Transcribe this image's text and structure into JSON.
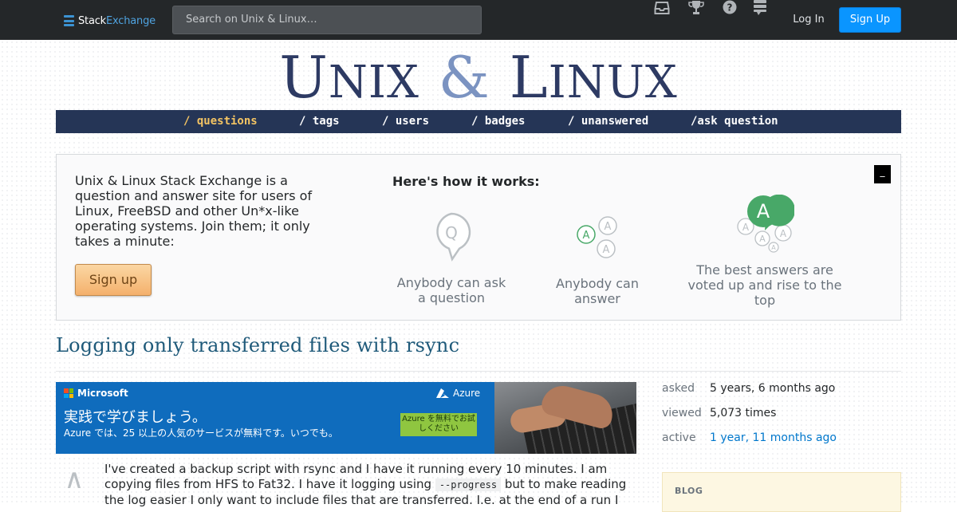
{
  "topbar": {
    "logo_stack": "Stack",
    "logo_exchange": "Exchange",
    "search_placeholder": "Search on Unix & Linux…",
    "icons": [
      "inbox-icon",
      "trophy-icon",
      "help-icon",
      "site-switcher-icon"
    ],
    "login_label": "Log In",
    "signup_label": "Sign Up"
  },
  "site": {
    "title_first": "U",
    "title_first_rest": "nix",
    "title_amp": "&",
    "title_second": "L",
    "title_second_rest": "inux"
  },
  "nav": {
    "items": [
      {
        "label": "/ questions",
        "active": true
      },
      {
        "label": "/ tags"
      },
      {
        "label": "/ users"
      },
      {
        "label": "/ badges"
      },
      {
        "label": "/ unanswered"
      },
      {
        "label": "/ask question"
      }
    ]
  },
  "hero": {
    "description": "Unix & Linux Stack Exchange is a question and answer site for users of Linux, FreeBSD and other Un*x-like operating systems. Join them; it only takes a minute:",
    "signup_label": "Sign up",
    "how_title": "Here's how it works:",
    "close_label": "_",
    "steps": [
      {
        "label": "Anybody can ask a question",
        "icon": "question-bubble-icon",
        "glyph": "Q"
      },
      {
        "label": "Anybody can answer",
        "icon": "answer-bubbles-icon",
        "glyph": "A"
      },
      {
        "label": "The best answers are voted up and rise to the top",
        "icon": "top-answer-icon",
        "glyph": "A"
      }
    ],
    "accent_green": "#48a868"
  },
  "question": {
    "title": "Logging only transferred files with rsync",
    "body_start": "I've created a backup script with rsync and I have it running every 10 minutes. I am copying files from HFS to Fat32. I have it logging using ",
    "body_code": "--progress",
    "body_end": " but to make reading the log easier I only want to include files that are transferred. I.e. at the end of a run I",
    "vote_up_glyph": "∧"
  },
  "ad": {
    "brand": "Microsoft",
    "product": "Azure",
    "headline": "実践で学びましょう。",
    "sub": "Azure では、25 以上の人気のサービスが無料です。いつでも。",
    "cta": "Azure を無料でお試しください",
    "color": "#0f6cbd"
  },
  "meta": {
    "asked_label": "asked",
    "asked_value": "5 years, 6 months ago",
    "viewed_label": "viewed",
    "viewed_value": "5,073 times",
    "active_label": "active",
    "active_value": "1 year, 11 months ago"
  },
  "sidebar": {
    "blog_label": "BLOG"
  },
  "colors": {
    "topbar": "#242729",
    "nav": "#253556",
    "nav_active": "#f4c463",
    "title": "#2d3a63",
    "title_amp": "#7b93c1",
    "question_title": "#1f5a7a",
    "signup_blue": "#0a95ff"
  }
}
